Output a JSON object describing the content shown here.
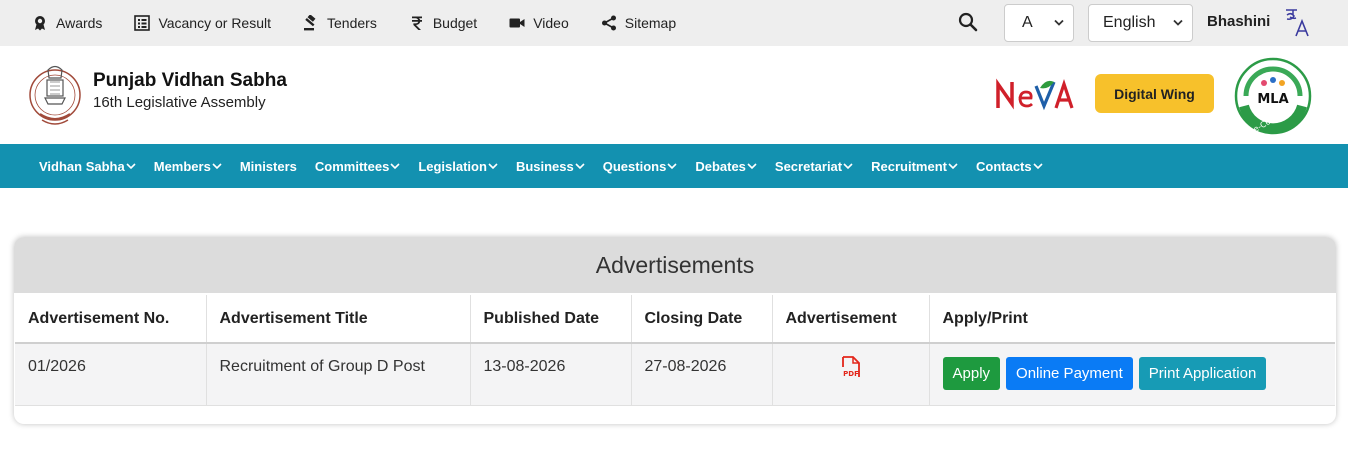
{
  "topbar": {
    "links": [
      {
        "label": "Awards",
        "icon": "award-icon"
      },
      {
        "label": "Vacancy or Result",
        "icon": "list-icon"
      },
      {
        "label": "Tenders",
        "icon": "gavel-icon"
      },
      {
        "label": "Budget",
        "icon": "rupee-icon"
      },
      {
        "label": "Video",
        "icon": "video-icon"
      },
      {
        "label": "Sitemap",
        "icon": "share-icon"
      }
    ],
    "font_size_value": "A",
    "language_value": "English",
    "bhashini_label": "Bhashini"
  },
  "header": {
    "title": "Punjab Vidhan Sabha",
    "subtitle": "16th Legislative Assembly",
    "neva_logo": "NeVA",
    "digital_wing_label": "Digital Wing",
    "mla_logo_text": "MLA",
    "mla_logo_subtext": "e-Connect"
  },
  "nav": {
    "items": [
      {
        "label": "Vidhan Sabha",
        "has_dropdown": true
      },
      {
        "label": "Members",
        "has_dropdown": true
      },
      {
        "label": "Ministers",
        "has_dropdown": false
      },
      {
        "label": "Committees",
        "has_dropdown": true
      },
      {
        "label": "Legislation",
        "has_dropdown": true
      },
      {
        "label": "Business",
        "has_dropdown": true
      },
      {
        "label": "Questions",
        "has_dropdown": true
      },
      {
        "label": "Debates",
        "has_dropdown": true
      },
      {
        "label": "Secretariat",
        "has_dropdown": true
      },
      {
        "label": "Recruitment",
        "has_dropdown": true
      },
      {
        "label": "Contacts",
        "has_dropdown": true
      }
    ]
  },
  "advertisements": {
    "title": "Advertisements",
    "columns": [
      "Advertisement No.",
      "Advertisement Title",
      "Published Date",
      "Closing Date",
      "Advertisement",
      "Apply/Print"
    ],
    "rows": [
      {
        "number": "01/2026",
        "title": "Recruitment of Group D Post",
        "published": "13-08-2026",
        "closing": "27-08-2026",
        "advertisement_icon": "pdf-icon",
        "pdf_label": "PDF",
        "apply_label": "Apply",
        "payment_label": "Online Payment",
        "print_label": "Print Application"
      }
    ]
  },
  "colors": {
    "nav_bg": "#1391b0",
    "digital_wing_bg": "#f7c12b",
    "apply_btn": "#1e9a3f",
    "payment_btn": "#0a7bf5",
    "print_btn": "#179bb5",
    "pdf_red": "#e3261b"
  }
}
